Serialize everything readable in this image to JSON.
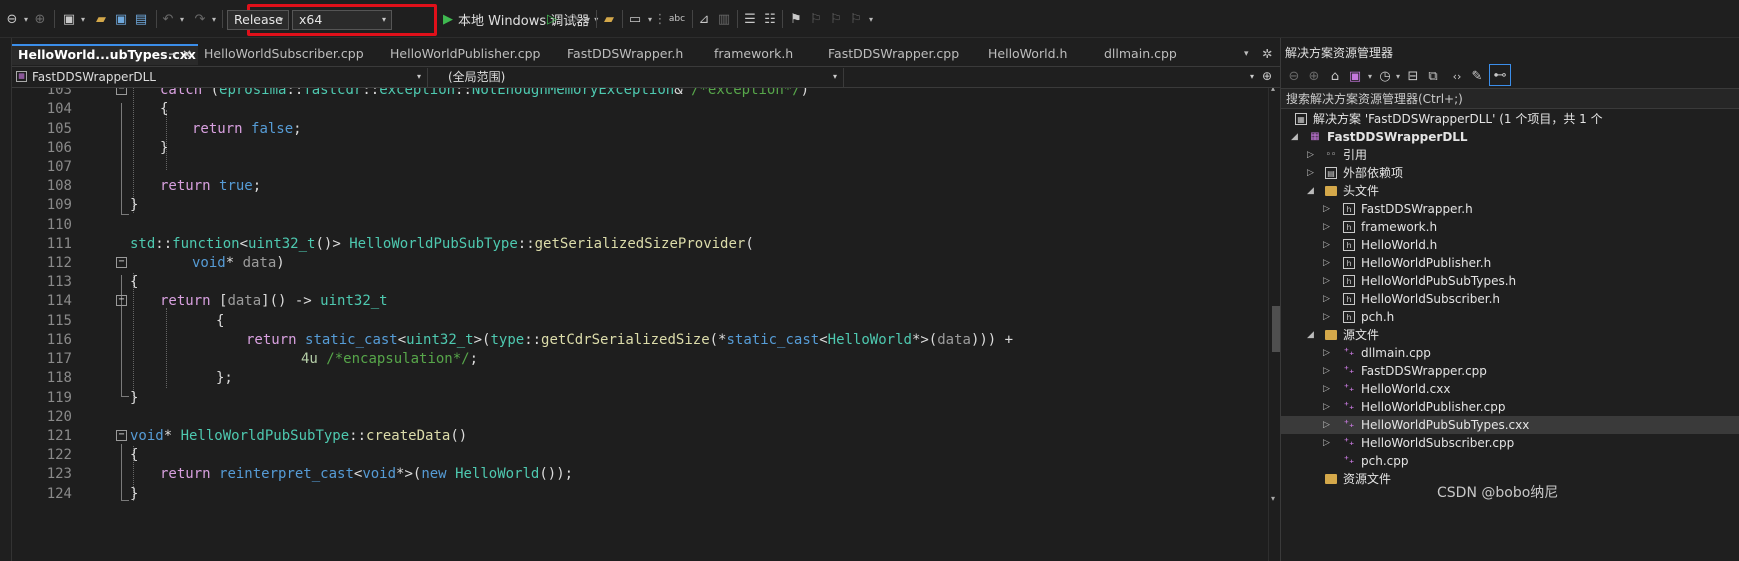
{
  "toolbar": {
    "configuration": "Release",
    "platform": "x64",
    "run_label": "本地 Windows 调试器"
  },
  "tabs": [
    {
      "label": "HelloWorld...ubTypes.cxx",
      "active": true
    },
    {
      "label": "HelloWorldSubscriber.cpp"
    },
    {
      "label": "HelloWorldPublisher.cpp"
    },
    {
      "label": "FastDDSWrapper.h"
    },
    {
      "label": "framework.h"
    },
    {
      "label": "FastDDSWrapper.cpp"
    },
    {
      "label": "HelloWorld.h"
    },
    {
      "label": "dllmain.cpp"
    }
  ],
  "navbar": {
    "project": "FastDDSWrapperDLL",
    "scope": "(全局范围)",
    "member": ""
  },
  "code": {
    "line_numbers": [
      "103",
      "104",
      "105",
      "106",
      "107",
      "108",
      "109",
      "110",
      "111",
      "112",
      "113",
      "114",
      "115",
      "116",
      "117",
      "118",
      "119",
      "120",
      "121",
      "122",
      "123",
      "124"
    ]
  },
  "solution_explorer": {
    "title": "解决方案资源管理器",
    "search_placeholder": "搜索解决方案资源管理器(Ctrl+;)",
    "solution_label": "解决方案 'FastDDSWrapperDLL' (1 个项目，共 1 个",
    "project": "FastDDSWrapperDLL",
    "references": "引用",
    "external_deps": "外部依赖项",
    "headers_folder": "头文件",
    "headers": [
      "FastDDSWrapper.h",
      "framework.h",
      "HelloWorld.h",
      "HelloWorldPublisher.h",
      "HelloWorldPubSubTypes.h",
      "HelloWorldSubscriber.h",
      "pch.h"
    ],
    "sources_folder": "源文件",
    "sources": [
      "dllmain.cpp",
      "FastDDSWrapper.cpp",
      "HelloWorld.cxx",
      "HelloWorldPublisher.cpp",
      "HelloWorldPubSubTypes.cxx",
      "HelloWorldSubscriber.cpp",
      "pch.cpp"
    ],
    "selected_source": "HelloWorldPubSubTypes.cxx",
    "resources_folder": "资源文件"
  },
  "watermark": "CSDN @bobo纳尼",
  "colors": {
    "highlight_box": "#e0101a",
    "active_tab_accent": "#3b8eea"
  }
}
